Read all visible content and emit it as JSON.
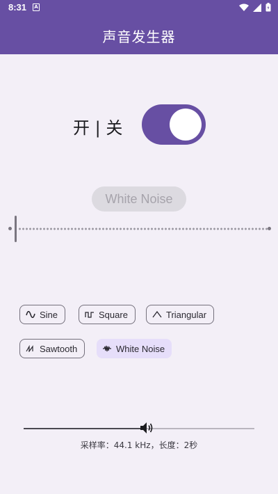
{
  "status_bar": {
    "time": "8:31",
    "notification_letter": "A"
  },
  "app_bar": {
    "title": "声音发生器"
  },
  "power": {
    "label": "开 | 关",
    "state": "on",
    "color": "#674fa3"
  },
  "current_wave": {
    "label": "White Noise"
  },
  "frequency_slider": {
    "level": 0.0
  },
  "waveforms": [
    {
      "label": "Sine",
      "icon": "sine-wave-icon",
      "selected": false
    },
    {
      "label": "Square",
      "icon": "square-wave-icon",
      "selected": false
    },
    {
      "label": "Triangular",
      "icon": "triangle-wave-icon",
      "selected": false
    },
    {
      "label": "Sawtooth",
      "icon": "sawtooth-wave-icon",
      "selected": false
    },
    {
      "label": "White Noise",
      "icon": "noise-wave-icon",
      "selected": true
    }
  ],
  "volume": {
    "level": 0.53,
    "icon": "volume-icon"
  },
  "info": {
    "text": "采样率：44.1 kHz，长度：2秒"
  }
}
